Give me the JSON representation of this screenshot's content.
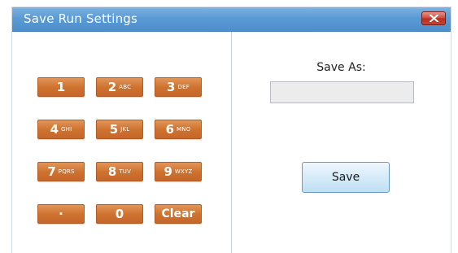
{
  "window": {
    "title": "Save Run Settings",
    "close_icon": "close-x-icon",
    "close_color": "#c8452f"
  },
  "keypad": {
    "accent_color": "#cf7330",
    "keys": [
      {
        "digit": "1",
        "letters": ""
      },
      {
        "digit": "2",
        "letters": "ABC"
      },
      {
        "digit": "3",
        "letters": "DEF"
      },
      {
        "digit": "4",
        "letters": "GHI"
      },
      {
        "digit": "5",
        "letters": "JKL"
      },
      {
        "digit": "6",
        "letters": "MNO"
      },
      {
        "digit": "7",
        "letters": "PQRS"
      },
      {
        "digit": "8",
        "letters": "TUV"
      },
      {
        "digit": "9",
        "letters": "WXYZ"
      },
      {
        "digit": "·",
        "letters": ""
      },
      {
        "digit": "0",
        "letters": ""
      },
      {
        "digit": "Clear",
        "letters": ""
      }
    ]
  },
  "save_panel": {
    "label": "Save As:",
    "input_value": "",
    "input_placeholder": "",
    "save_button_label": "Save"
  }
}
